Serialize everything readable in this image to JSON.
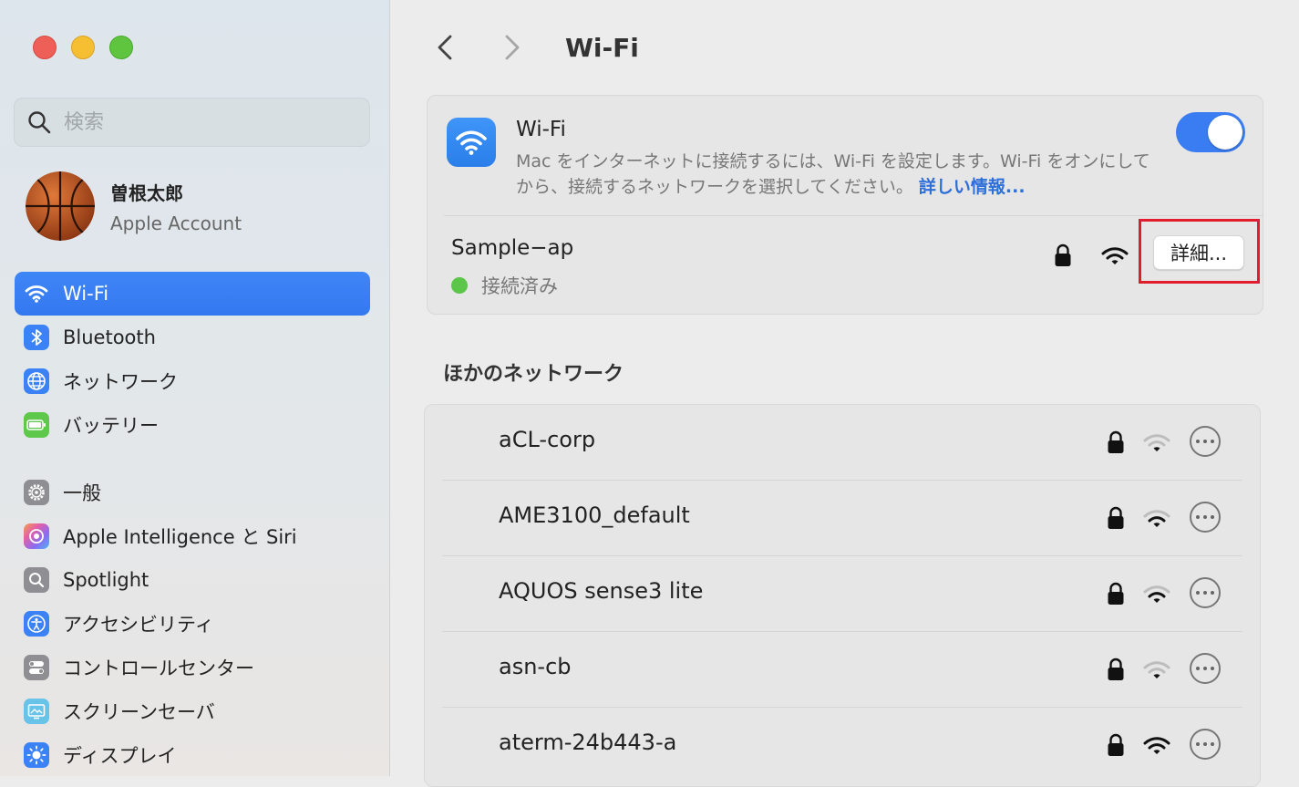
{
  "sidebar": {
    "search_placeholder": "検索",
    "account": {
      "name": "曽根太郎",
      "subtitle": "Apple Account"
    },
    "items": [
      {
        "label": "Wi-Fi",
        "icon": "wifi-icon",
        "color": "#3a82f6",
        "active": true
      },
      {
        "label": "Bluetooth",
        "icon": "bluetooth-icon",
        "color": "#3a82f6"
      },
      {
        "label": "ネットワーク",
        "icon": "globe-icon",
        "color": "#3a82f6"
      },
      {
        "label": "バッテリー",
        "icon": "battery-icon",
        "color": "#5dc84a"
      },
      {
        "label": "一般",
        "icon": "gear-icon",
        "color": "#8e8e93"
      },
      {
        "label": "Apple Intelligence と Siri",
        "icon": "siri-icon",
        "color": "#d67cf0"
      },
      {
        "label": "Spotlight",
        "icon": "magnifier-icon",
        "color": "#8e8e93"
      },
      {
        "label": "アクセシビリティ",
        "icon": "accessibility-icon",
        "color": "#3a82f6"
      },
      {
        "label": "コントロールセンター",
        "icon": "toggles-icon",
        "color": "#8e8e93"
      },
      {
        "label": "スクリーンセーバ",
        "icon": "screensaver-icon",
        "color": "#67c3e8"
      },
      {
        "label": "ディスプレイ",
        "icon": "sun-icon",
        "color": "#3a82f6"
      }
    ]
  },
  "main": {
    "title": "Wi-Fi",
    "wifi": {
      "title": "Wi-Fi",
      "description": "Mac をインターネットに接続するには、Wi-Fi を設定します。Wi-Fi をオンにしてから、接続するネットワークを選択してください。",
      "more_info": "詳しい情報...",
      "enabled": true
    },
    "connected": {
      "name": "Sample−ap",
      "status": "接続済み",
      "details_button": "詳細..."
    },
    "other_networks_title": "ほかのネットワーク",
    "networks": [
      {
        "name": "aCL-corp",
        "locked": true,
        "signal": 1
      },
      {
        "name": "AME3100_default",
        "locked": true,
        "signal": 2
      },
      {
        "name": "AQUOS sense3 lite",
        "locked": true,
        "signal": 2
      },
      {
        "name": "asn-cb",
        "locked": true,
        "signal": 1
      },
      {
        "name": "aterm-24b443-a",
        "locked": true,
        "signal": 3
      }
    ]
  }
}
